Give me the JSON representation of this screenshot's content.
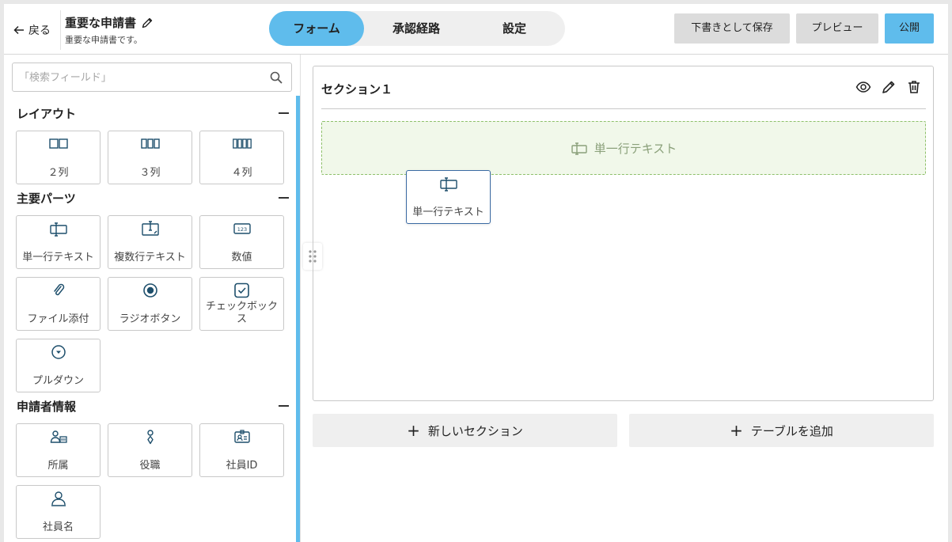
{
  "header": {
    "back_label": "戻る",
    "title": "重要な申請書",
    "subtitle": "重要な申請書です。",
    "tabs": [
      {
        "label": "フォーム",
        "active": true
      },
      {
        "label": "承認経路",
        "active": false
      },
      {
        "label": "設定",
        "active": false
      }
    ],
    "save_draft_label": "下書きとして保存",
    "preview_label": "プレビュー",
    "publish_label": "公開"
  },
  "sidebar": {
    "search_placeholder": "「検索フィールド」",
    "categories": [
      {
        "title": "レイアウト",
        "items": [
          {
            "label": "２列",
            "icon": "two-columns-icon"
          },
          {
            "label": "３列",
            "icon": "three-columns-icon"
          },
          {
            "label": "４列",
            "icon": "four-columns-icon"
          }
        ]
      },
      {
        "title": "主要パーツ",
        "items": [
          {
            "label": "単一行テキスト",
            "icon": "single-line-text-icon"
          },
          {
            "label": "複数行テキスト",
            "icon": "multi-line-text-icon"
          },
          {
            "label": "数値",
            "icon": "number-icon"
          },
          {
            "label": "ファイル添付",
            "icon": "paperclip-icon"
          },
          {
            "label": "ラジオボタン",
            "icon": "radio-button-icon"
          },
          {
            "label": "チェックボックス",
            "icon": "checkbox-icon"
          },
          {
            "label": "プルダウン",
            "icon": "dropdown-icon"
          }
        ]
      },
      {
        "title": "申請者情報",
        "items": [
          {
            "label": "所属",
            "icon": "department-icon"
          },
          {
            "label": "役職",
            "icon": "position-icon"
          },
          {
            "label": "社員ID",
            "icon": "id-card-icon"
          },
          {
            "label": "社員名",
            "icon": "person-icon"
          }
        ]
      }
    ],
    "number_icon_text": "123"
  },
  "canvas": {
    "section_title": "セクション１",
    "dropzone_label": "単一行テキスト",
    "drag_ghost_label": "単一行テキスト",
    "new_section_label": "新しいセクション",
    "add_table_label": "テーブルを追加",
    "plus_glyph": "+"
  },
  "colors": {
    "accent": "#5fbcec",
    "dropzone_border": "#8ec06a",
    "dropzone_bg": "#f1f8ea",
    "icon": "#1d4e6b"
  }
}
